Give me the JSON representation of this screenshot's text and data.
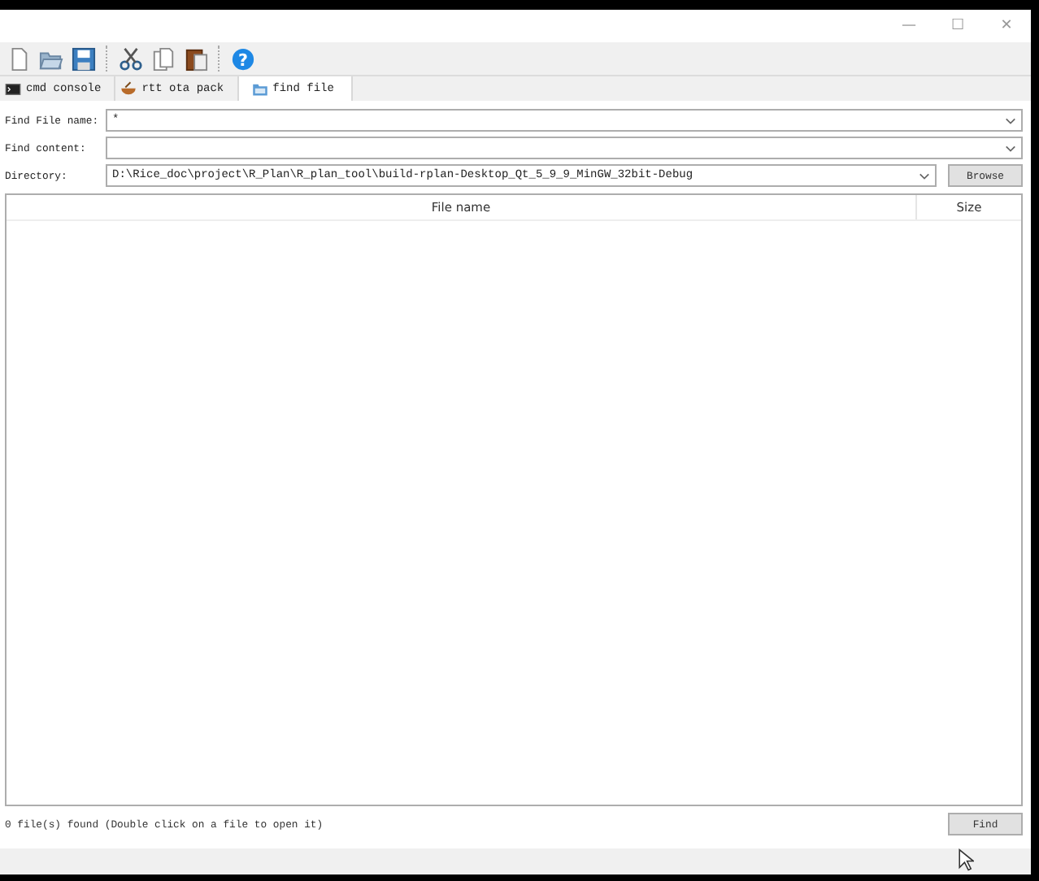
{
  "window": {
    "controls": [
      "—",
      "☐",
      "✕"
    ]
  },
  "toolbar": {
    "help_mark": "?"
  },
  "tabs": [
    {
      "label": "cmd console",
      "selected": false
    },
    {
      "label": "rtt ota pack",
      "selected": false
    },
    {
      "label": "find file",
      "selected": true
    }
  ],
  "form": [
    {
      "label": "Find File name:",
      "value": "*",
      "kind": "combo"
    },
    {
      "label": "Find content:",
      "kind": "combo"
    },
    {
      "label": "Directory:",
      "value": "D:\\Rice_doc\\project\\R_Plan\\R_plan_tool\\build-rplan-Desktop_Qt_5_9_9_MinGW_32bit-Debug",
      "kind": "combo-browse",
      "button": "Browse"
    }
  ],
  "table": {
    "columns": [
      "File name",
      "Size"
    ]
  },
  "status": "0 file(s) found (Double click on a file to open it)",
  "buttons": [
    "Find"
  ]
}
